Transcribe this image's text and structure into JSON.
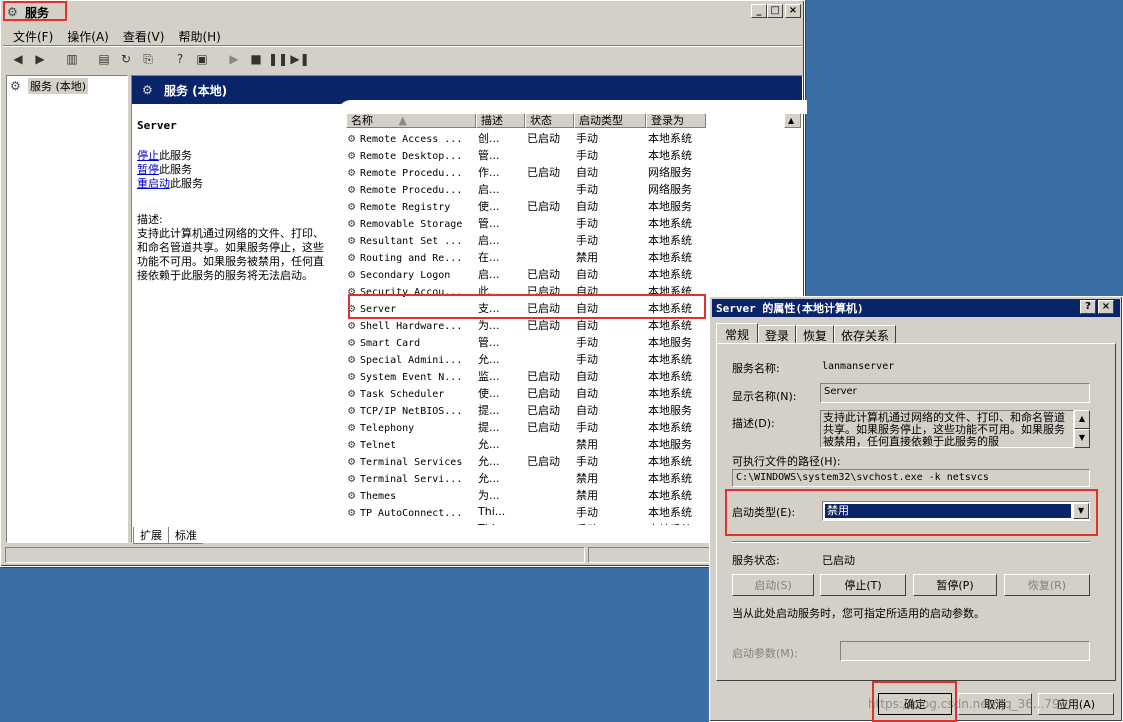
{
  "main": {
    "title": "服务",
    "menus": [
      "文件(F)",
      "操作(A)",
      "查看(V)",
      "帮助(H)"
    ],
    "tree_root": "服务 (本地)",
    "header_title": "服务 (本地)",
    "selected_service": "Server",
    "actions": [
      {
        "link": "停止",
        "rest": "此服务"
      },
      {
        "link": "暂停",
        "rest": "此服务"
      },
      {
        "link": "重启动",
        "rest": "此服务"
      }
    ],
    "desc_label": "描述:",
    "desc_text": "支持此计算机通过网络的文件、打印、和命名管道共享。如果服务停止，这些功能不可用。如果服务被禁用，任何直接依赖于此服务的服务将无法启动。",
    "columns": [
      "名称",
      "描述",
      "状态",
      "启动类型",
      "登录为"
    ],
    "rows": [
      [
        "Remote Access ...",
        "创...",
        "已启动",
        "手动",
        "本地系统"
      ],
      [
        "Remote Desktop...",
        "管...",
        "",
        "手动",
        "本地系统"
      ],
      [
        "Remote Procedu...",
        "作...",
        "已启动",
        "自动",
        "网络服务"
      ],
      [
        "Remote Procedu...",
        "启...",
        "",
        "手动",
        "网络服务"
      ],
      [
        "Remote Registry",
        "使...",
        "已启动",
        "自动",
        "本地服务"
      ],
      [
        "Removable Storage",
        "管...",
        "",
        "手动",
        "本地系统"
      ],
      [
        "Resultant Set ...",
        "启...",
        "",
        "手动",
        "本地系统"
      ],
      [
        "Routing and Re...",
        "在...",
        "",
        "禁用",
        "本地系统"
      ],
      [
        "Secondary Logon",
        "启...",
        "已启动",
        "自动",
        "本地系统"
      ],
      [
        "Security Accou...",
        "此...",
        "已启动",
        "自动",
        "本地系统"
      ],
      [
        "Server",
        "支...",
        "已启动",
        "自动",
        "本地系统"
      ],
      [
        "Shell Hardware...",
        "为...",
        "已启动",
        "自动",
        "本地系统"
      ],
      [
        "Smart Card",
        "管...",
        "",
        "手动",
        "本地服务"
      ],
      [
        "Special Admini...",
        "允...",
        "",
        "手动",
        "本地系统"
      ],
      [
        "System Event N...",
        "监...",
        "已启动",
        "自动",
        "本地系统"
      ],
      [
        "Task Scheduler",
        "使...",
        "已启动",
        "自动",
        "本地系统"
      ],
      [
        "TCP/IP NetBIOS...",
        "提...",
        "已启动",
        "自动",
        "本地服务"
      ],
      [
        "Telephony",
        "提...",
        "已启动",
        "手动",
        "本地系统"
      ],
      [
        "Telnet",
        "允...",
        "",
        "禁用",
        "本地服务"
      ],
      [
        "Terminal Services",
        "允...",
        "已启动",
        "手动",
        "本地系统"
      ],
      [
        "Terminal Servi...",
        "允...",
        "",
        "禁用",
        "本地系统"
      ],
      [
        "Themes",
        "为...",
        "",
        "禁用",
        "本地系统"
      ],
      [
        "TP AutoConnect...",
        "Thi...",
        "",
        "手动",
        "本地系统"
      ],
      [
        "TP VC Gateway",
        "Thi...",
        "",
        "手动",
        "本地系统"
      ]
    ],
    "tabs": [
      "扩展",
      "标准"
    ]
  },
  "dialog": {
    "title": "Server 的属性(本地计算机)",
    "tabs": [
      "常规",
      "登录",
      "恢复",
      "依存关系"
    ],
    "service_name_label": "服务名称:",
    "service_name": "lanmanserver",
    "display_name_label": "显示名称(N):",
    "display_name": "Server",
    "desc_label": "描述(D):",
    "desc": "支持此计算机通过网络的文件、打印、和命名管道共享。如果服务停止，这些功能不可用。如果服务被禁用，任何直接依赖于此服务的服",
    "path_label": "可执行文件的路径(H):",
    "path": "C:\\WINDOWS\\system32\\svchost.exe -k netsvcs",
    "startup_label": "启动类型(E):",
    "startup_value": "禁用",
    "status_label": "服务状态:",
    "status_value": "已启动",
    "buttons": [
      "启动(S)",
      "停止(T)",
      "暂停(P)",
      "恢复(R)"
    ],
    "hint": "当从此处启动服务时，您可指定所适用的启动参数。",
    "param_label": "启动参数(M):",
    "ok": "确定",
    "cancel": "取消",
    "apply": "应用(A)",
    "watermark": "https://blog.csdn.net/qq_36...791"
  }
}
